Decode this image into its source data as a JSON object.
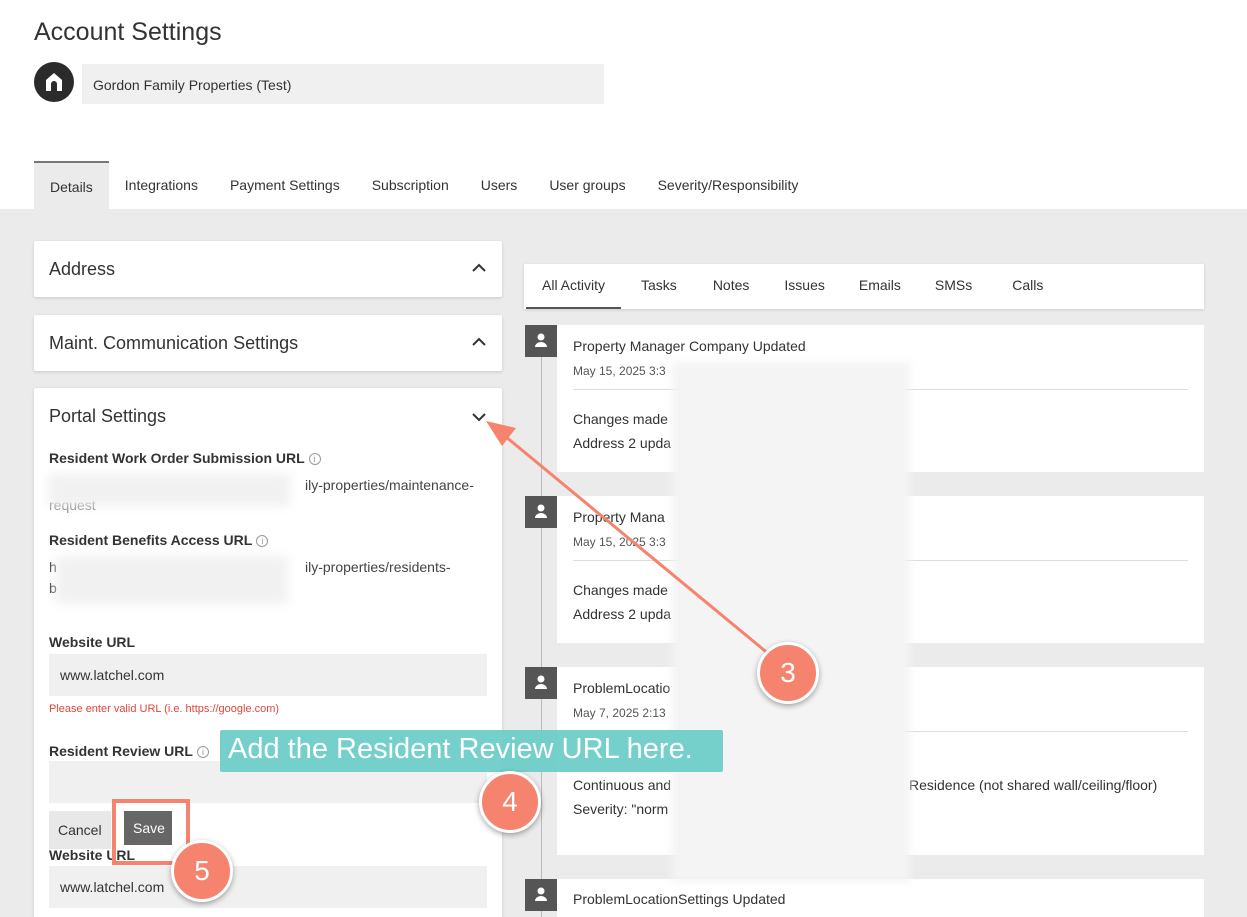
{
  "page": {
    "title": "Account Settings",
    "company_name": "Gordon Family Properties (Test)"
  },
  "tabs": [
    "Details",
    "Integrations",
    "Payment Settings",
    "Subscription",
    "Users",
    "User groups",
    "Severity/Responsibility"
  ],
  "sections": {
    "address": {
      "title": "Address"
    },
    "maint": {
      "title": "Maint. Communication Settings"
    },
    "portal": {
      "title": "Portal Settings",
      "work_order_label": "Resident Work Order Submission URL",
      "work_order_url_line1": "ily-properties/maintenance-",
      "work_order_url_line2": "request",
      "benefits_label": "Resident Benefits Access URL",
      "benefits_url_line1_start": "h",
      "benefits_url_line1": "ily-properties/residents-",
      "benefits_url_line2": "b",
      "website_label": "Website URL",
      "website_value": "www.latchel.com",
      "website_error": "Please enter valid URL (i.e. https://google.com)",
      "review_label": "Resident Review URL",
      "review_value": "",
      "cancel_label": "Cancel",
      "save_label": "Save",
      "website_label_2": "Website URL",
      "website_value_2": "www.latchel.com"
    }
  },
  "activity": {
    "tabs": [
      "All Activity",
      "Tasks",
      "Notes",
      "Issues",
      "Emails",
      "SMSs",
      "Calls"
    ],
    "items": [
      {
        "title": "Property Manager Company Updated",
        "date": "May 15, 2025 3:3",
        "line1": "Changes made",
        "line2": "Address 2 upda"
      },
      {
        "title": "Property Mana",
        "date": "May 15, 2025 3:3",
        "line1": "Changes made",
        "line2": "Address 2 upda"
      },
      {
        "title": "ProblemLocatio",
        "date": "May 7, 2025 2:13",
        "line1": "Continuous and",
        "line1_end": "Residence (not shared wall/ceiling/floor)",
        "line2": "Severity: \"norm"
      },
      {
        "title": "ProblemLocationSettings Updated"
      }
    ]
  },
  "annotations": {
    "callout": "Add the Resident Review URL here.",
    "step3": "3",
    "step4": "4",
    "step5": "5"
  },
  "colors": {
    "accent": "#f6836d",
    "callout": "#6ecec8",
    "error": "#e0453b"
  }
}
